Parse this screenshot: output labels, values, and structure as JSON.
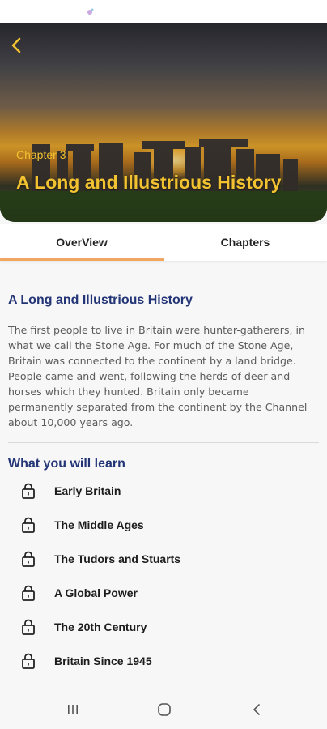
{
  "hero": {
    "chapter_label": "Chapter 3",
    "title": "A Long and Illustrious History"
  },
  "tabs": [
    {
      "label": "OverView",
      "active": true
    },
    {
      "label": "Chapters",
      "active": false
    }
  ],
  "overview": {
    "title": "A Long and Illustrious History",
    "body": "The first people to live in Britain were hunter-gatherers, in what we call the Stone Age. For much of the Stone Age, Britain was connected to the continent by a land bridge. People came and went, following the herds of deer and horses which they hunted. Britain only became permanently separated from the continent by the Channel about 10,000 years ago."
  },
  "learn": {
    "title": "What you will learn",
    "items": [
      {
        "label": "Early Britain",
        "icon": "lock-icon"
      },
      {
        "label": "The Middle Ages",
        "icon": "lock-icon"
      },
      {
        "label": "The Tudors and Stuarts",
        "icon": "lock-icon"
      },
      {
        "label": "A Global Power",
        "icon": "lock-icon"
      },
      {
        "label": "The 20th Century",
        "icon": "lock-icon"
      },
      {
        "label": "Britain Since 1945",
        "icon": "lock-icon"
      }
    ]
  },
  "colors": {
    "accent_gold": "#f2c230",
    "heading_navy": "#233577",
    "tab_indicator": "#f1a760"
  },
  "icons": {
    "back": "chevron-left-icon",
    "nav_recents": "recent-apps-icon",
    "nav_home": "home-icon",
    "nav_back": "back-icon"
  }
}
